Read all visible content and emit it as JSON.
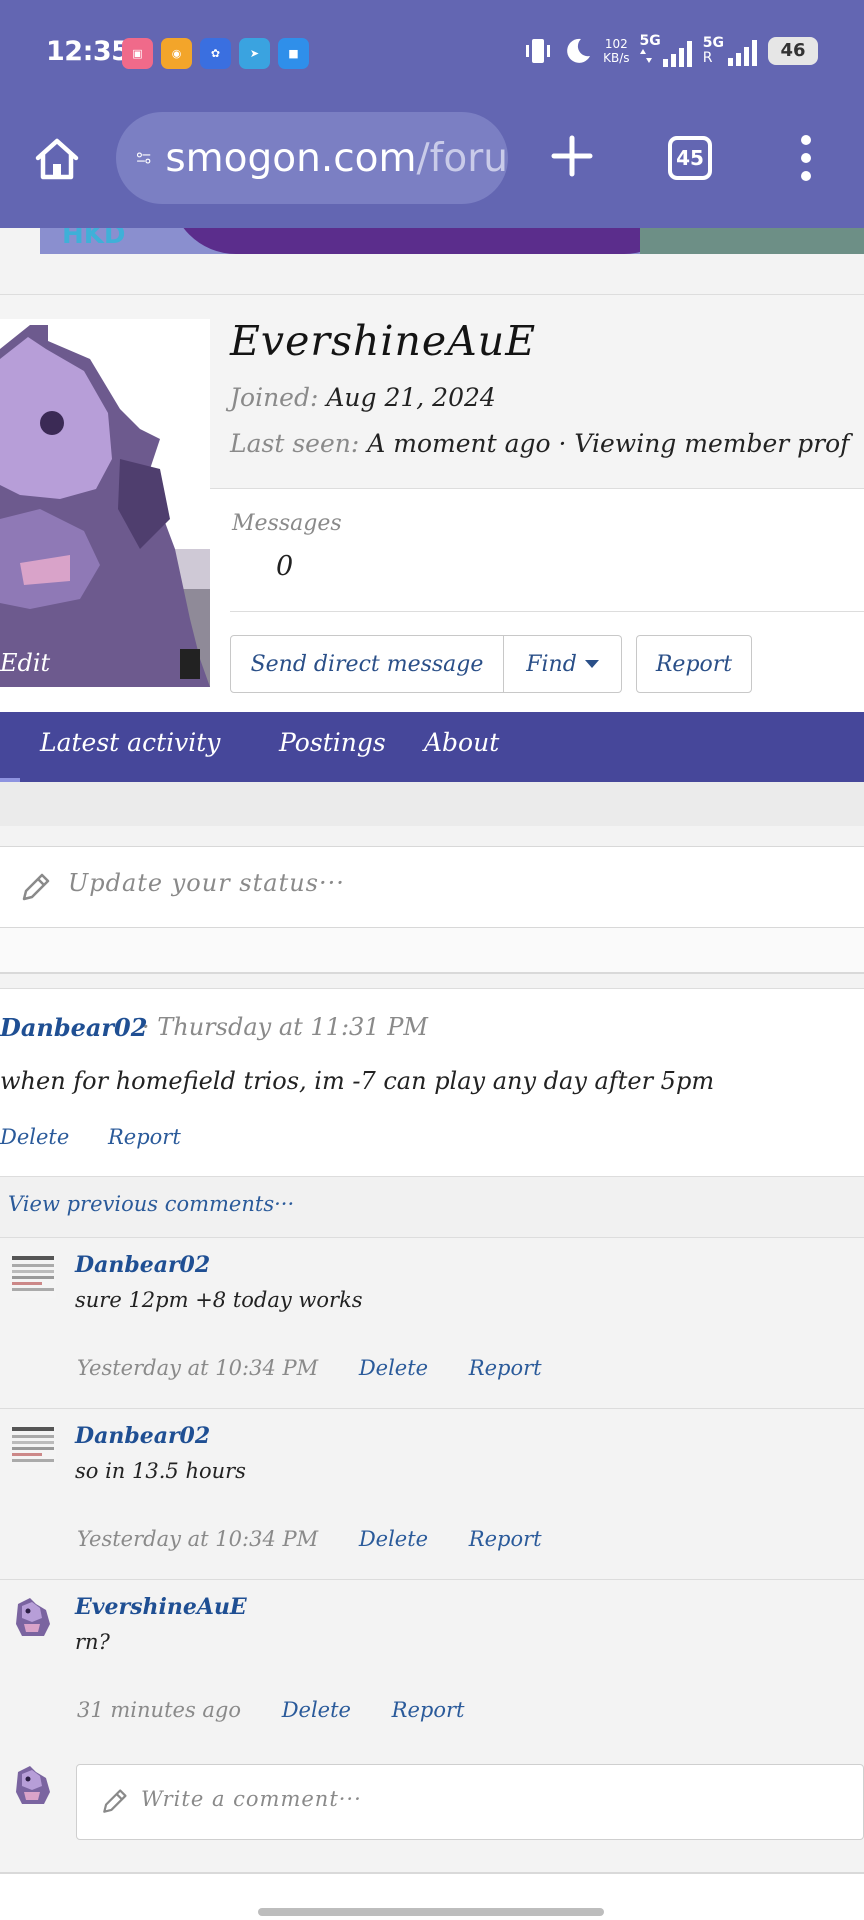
{
  "status_bar": {
    "time": "12:35",
    "speed_value": "102",
    "speed_unit": "KB/s",
    "net1": "5G",
    "net2": "5G",
    "net2_sub": "R",
    "battery": "46",
    "apps": [
      "bilibili-icon",
      "weibo-icon",
      "baidu-icon",
      "telegram-icon",
      "files-icon"
    ]
  },
  "browser": {
    "url_main": "smogon.com",
    "url_rest": "/foru",
    "tab_count": "45"
  },
  "banner": {
    "text": "HKD"
  },
  "profile": {
    "username": "EvershineAuE",
    "joined_label": "Joined:",
    "joined_value": "Aug 21, 2024",
    "last_seen_label": "Last seen:",
    "last_seen_value": "A moment ago · Viewing member prof",
    "messages_label": "Messages",
    "messages_value": "0",
    "edit_label": "Edit",
    "buttons": {
      "send": "Send direct message",
      "find": "Find",
      "report": "Report"
    }
  },
  "tabs": [
    "Latest activity",
    "Postings",
    "About"
  ],
  "status_update": {
    "placeholder": "Update your status···"
  },
  "post": {
    "author": "Danbear02",
    "time": "· Thursday at 11:31 PM",
    "text": "when for homefield trios, im -7 can play any day after 5pm",
    "delete": "Delete",
    "report": "Report"
  },
  "view_previous": "View previous comments···",
  "comments": [
    {
      "author": "Danbear02",
      "text": "sure 12pm +8 today works",
      "time": "Yesterday at 10:34 PM",
      "delete": "Delete",
      "report": "Report"
    },
    {
      "author": "Danbear02",
      "text": "so in 13.5 hours",
      "time": "Yesterday at 10:34 PM",
      "delete": "Delete",
      "report": "Report"
    },
    {
      "author": "EvershineAuE",
      "text": "rn?",
      "time": "31 minutes ago",
      "delete": "Delete",
      "report": "Report"
    }
  ],
  "write_comment": {
    "placeholder": "Write a comment···"
  },
  "colors": {
    "brand": "#6366b2",
    "tabbar": "#46479a",
    "link": "#2a5a9a",
    "username_link": "#1f4f93"
  }
}
